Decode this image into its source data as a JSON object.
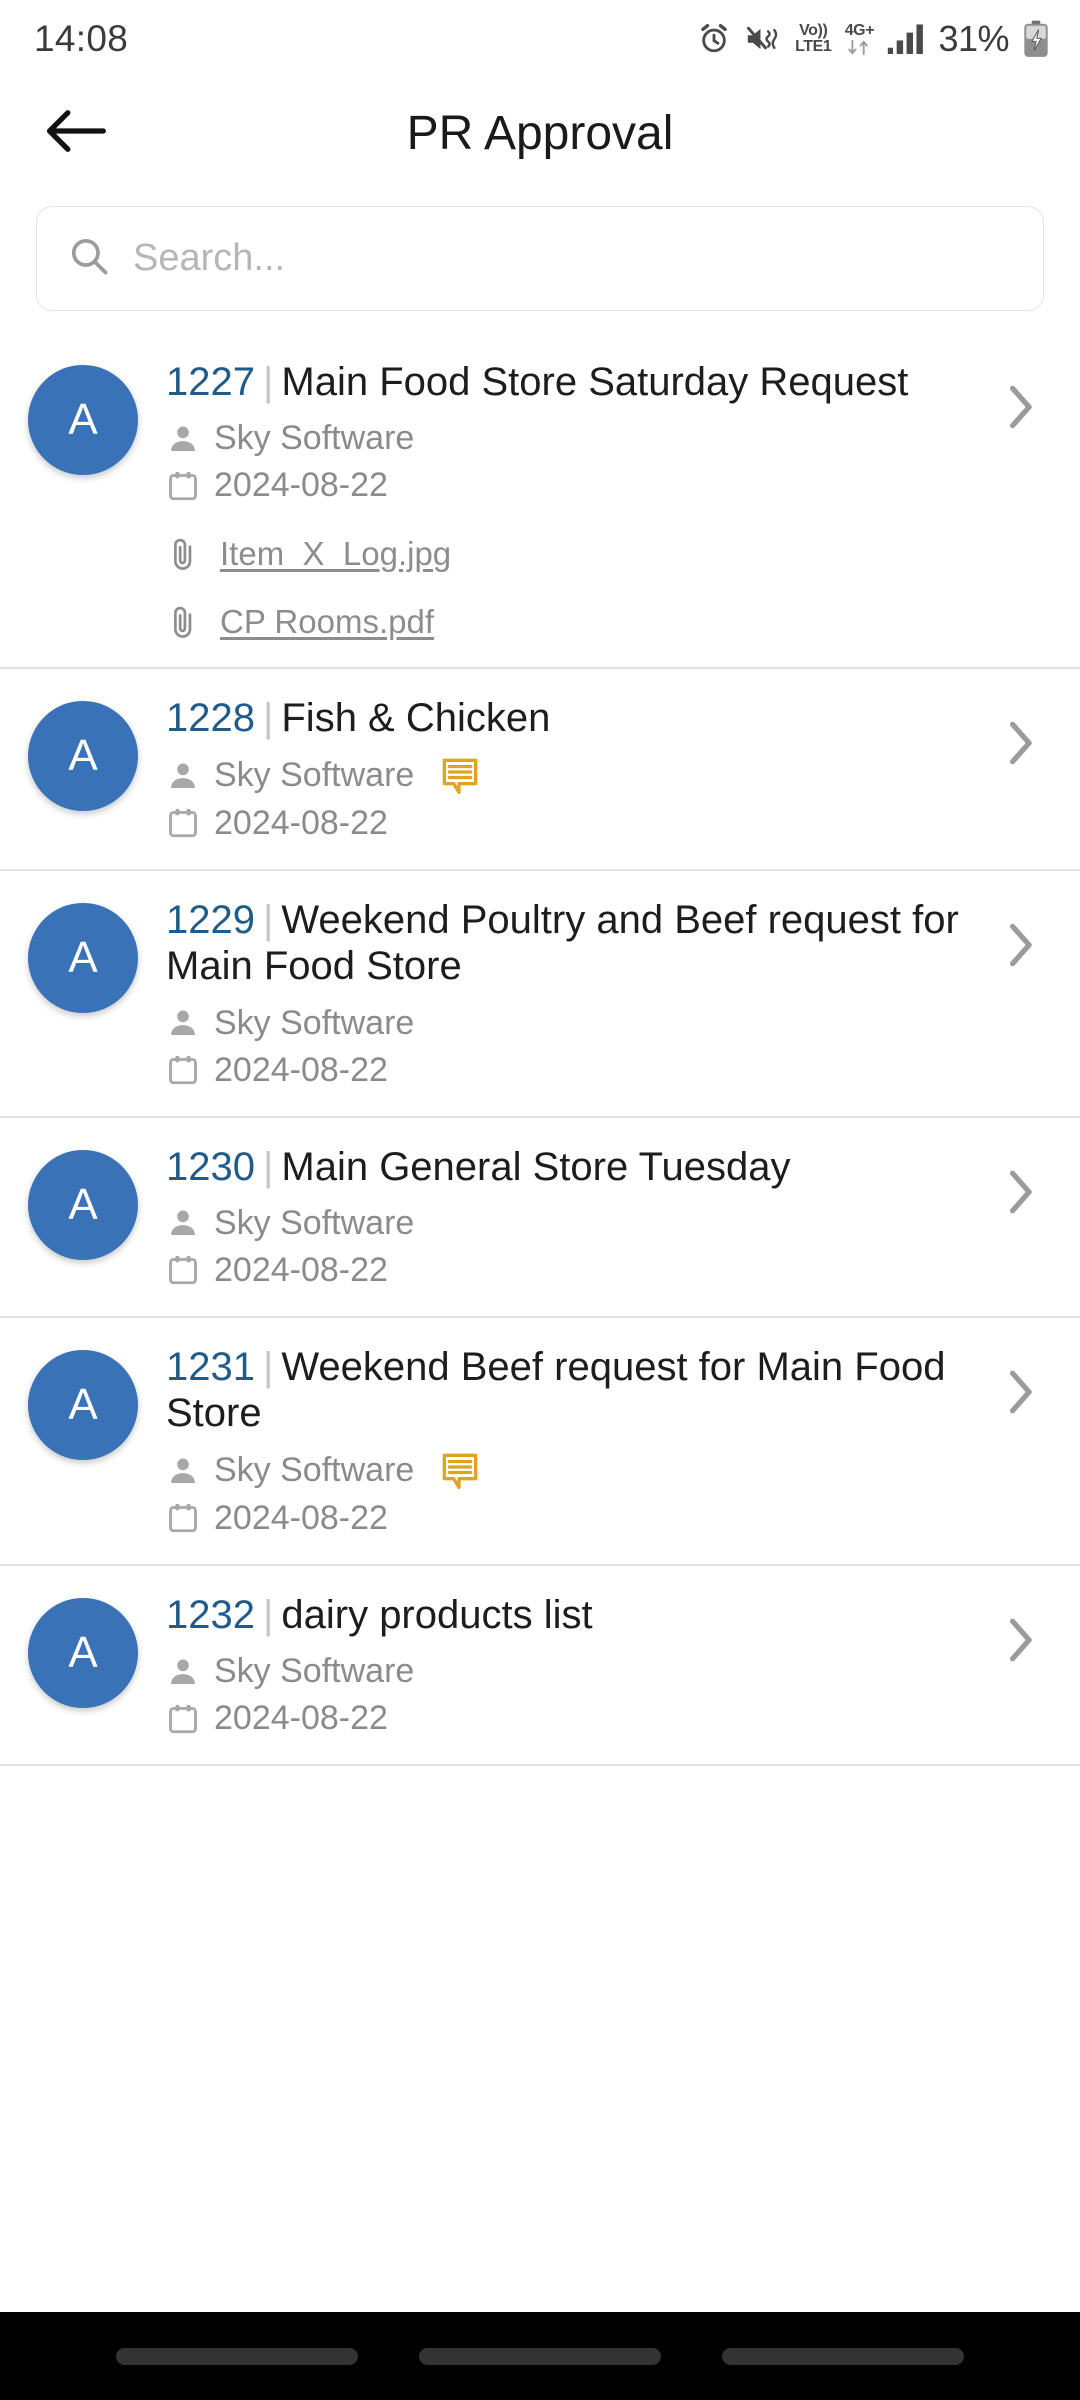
{
  "status_bar": {
    "time": "14:08",
    "battery_percent": "31%",
    "network_top": "Vo))",
    "network_bottom": "LTE1",
    "data_type": "4G+",
    "icons": [
      "alarm-icon",
      "mute-vibrate-icon",
      "volte-icon",
      "data-arrows-icon",
      "signal-bars-icon",
      "battery-charging-icon"
    ]
  },
  "app_bar": {
    "title": "PR Approval",
    "back_icon": "arrow-left-icon"
  },
  "search": {
    "placeholder": "Search...",
    "value": "",
    "icon": "search-icon"
  },
  "colors": {
    "avatar_blue": "#3a72b8",
    "id_blue": "#1f5c8b",
    "comment_amber": "#dda520",
    "muted_grey": "#8b8b8b",
    "divider": "#e2e2e4"
  },
  "list": {
    "items": [
      {
        "avatar_letter": "A",
        "id": "1227",
        "separator": "|",
        "title": "Main Food Store Saturday Request",
        "requester": "Sky Software",
        "date": "2024-08-22",
        "has_comment": false,
        "attachments": [
          "Item_X_Log.jpg",
          "CP Rooms.pdf"
        ]
      },
      {
        "avatar_letter": "A",
        "id": "1228",
        "separator": "|",
        "title": "Fish & Chicken",
        "requester": "Sky Software",
        "date": "2024-08-22",
        "has_comment": true,
        "attachments": []
      },
      {
        "avatar_letter": "A",
        "id": "1229",
        "separator": "|",
        "title": "Weekend Poultry and Beef request for Main Food Store",
        "requester": "Sky Software",
        "date": "2024-08-22",
        "has_comment": false,
        "attachments": []
      },
      {
        "avatar_letter": "A",
        "id": "1230",
        "separator": "|",
        "title": "Main General Store Tuesday",
        "requester": "Sky Software",
        "date": "2024-08-22",
        "has_comment": false,
        "attachments": []
      },
      {
        "avatar_letter": "A",
        "id": "1231",
        "separator": "|",
        "title": "Weekend Beef request for Main Food Store",
        "requester": "Sky Software",
        "date": "2024-08-22",
        "has_comment": true,
        "attachments": []
      },
      {
        "avatar_letter": "A",
        "id": "1232",
        "separator": "|",
        "title": "dairy products list",
        "requester": "Sky Software",
        "date": "2024-08-22",
        "has_comment": false,
        "attachments": []
      }
    ]
  },
  "nav_bar": {
    "buttons": [
      "recents-button",
      "home-button",
      "back-button"
    ]
  }
}
